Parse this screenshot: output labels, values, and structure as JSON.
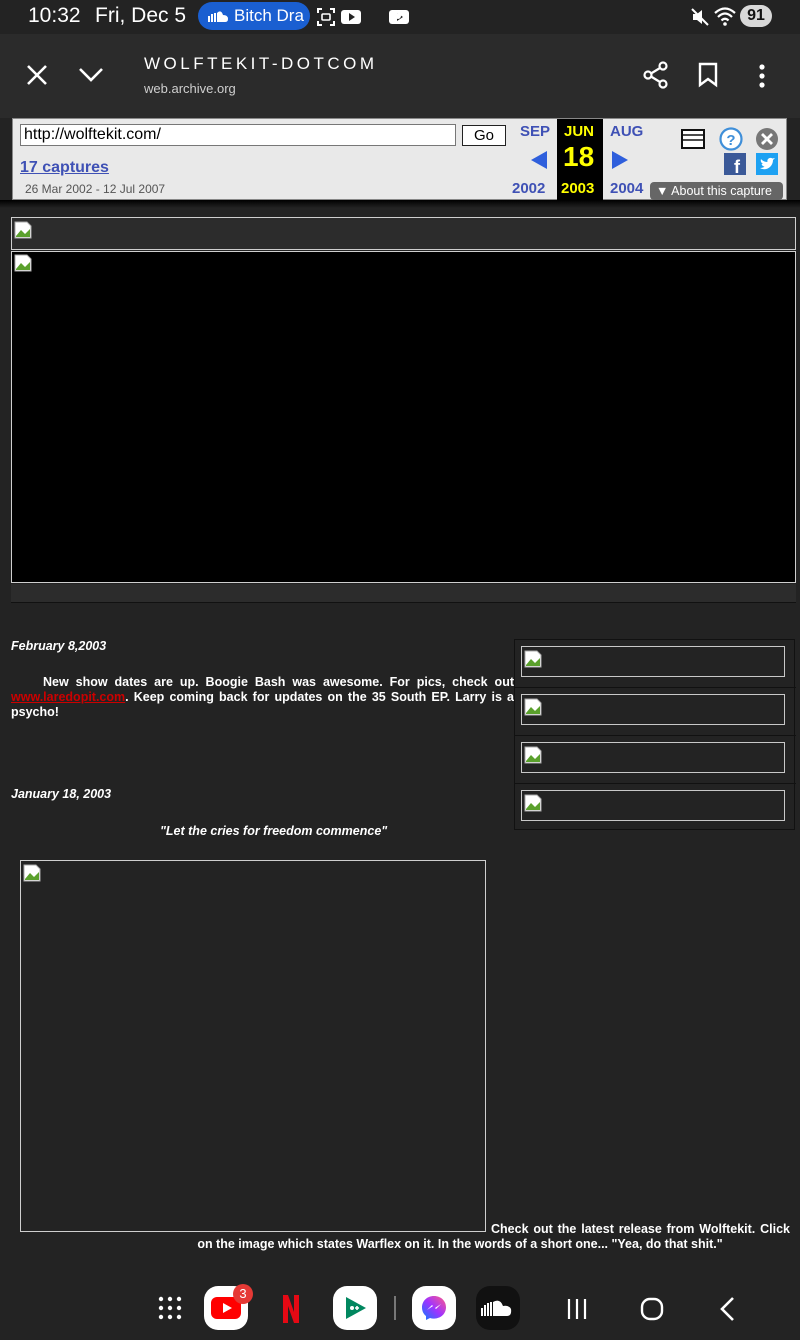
{
  "status_bar": {
    "time": "10:32",
    "date": "Fri, Dec 5",
    "media_pill_text": "Bitch Dra",
    "battery": "91"
  },
  "browser": {
    "site_title": "WOLFTEKIT-DOTCOM",
    "site_domain": "web.archive.org",
    "icons": [
      "close-icon",
      "chevron-down-icon",
      "share-icon",
      "bookmark-icon",
      "more-vert-icon"
    ]
  },
  "wayback": {
    "url_value": "http://wolftekit.com/",
    "go_label": "Go",
    "captures_link": "17 captures",
    "date_range": "26 Mar 2002 - 12 Jul 2007",
    "prev_month": "SEP",
    "current_month": "JUN",
    "next_month": "AUG",
    "current_day": "18",
    "prev_year": "2002",
    "current_year": "2003",
    "next_year": "2004",
    "about_label": "About this capture",
    "colors": {
      "accent": "#3f51b5",
      "highlight": "#ffff00"
    }
  },
  "page": {
    "news": [
      {
        "date": "February 8,2003",
        "body_before_link": "New show dates are up. Boogie Bash was awesome.  For pics, check out ",
        "link": "www.laredopit.com",
        "body_after_link": ".  Keep coming back for updates on the 35 South EP.  Larry is a psycho!"
      },
      {
        "date": "January 18, 2003",
        "quote": "\"Let the cries for freedom commence\"",
        "caption": "Check out the latest release from Wolftekit.  Click on the image which states Warflex on it.  In the words of a short one... \"Yea, do that shit.\""
      }
    ]
  },
  "nav_bar": {
    "youtube_badge": "3",
    "apps": [
      "apps-grid-icon",
      "youtube-icon",
      "netflix-icon",
      "play-games-icon",
      "messenger-icon",
      "soundcloud-icon"
    ],
    "buttons": [
      "recents-button",
      "home-button",
      "back-button"
    ]
  }
}
